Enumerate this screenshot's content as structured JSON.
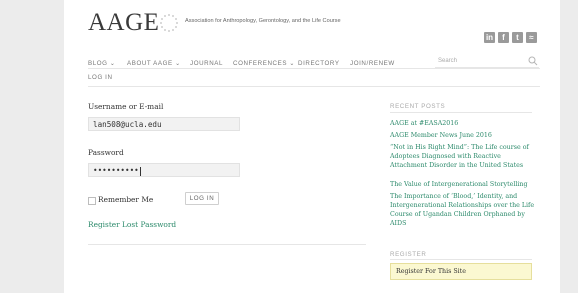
{
  "header": {
    "logo": "AAGE",
    "tagline": "Association for Anthropology, Gerontology, and the Life Course",
    "social_icons": [
      "linkedin-icon",
      "facebook-icon",
      "twitter-icon",
      "rss-icon"
    ]
  },
  "nav": {
    "items": [
      "BLOG ⌄",
      "ABOUT AAGE ⌄",
      "JOURNAL",
      "CONFERENCES ⌄",
      "DIRECTORY",
      "JOIN/RENEW"
    ],
    "login_tab": "LOG IN",
    "search_placeholder": "Search"
  },
  "form": {
    "username_label": "Username or E-mail",
    "username_value": "lan508@ucla.edu",
    "password_label": "Password",
    "password_value": "••••••••••",
    "remember_label": "Remember Me",
    "login_button": "LOG IN",
    "register_link": "Register",
    "lost_password_link": "Lost Password"
  },
  "sidebar": {
    "recent_posts_heading": "RECENT POSTS",
    "posts": [
      "AAGE at #EASA2016",
      "AAGE Member News June 2016",
      "“Not in His Right Mind”: The Life course of Adoptees Diagnosed with Reactive Attachment Disorder in the United States",
      "The Value of Intergenerational Storytelling",
      "The Importance of ‘Blood,’ Identity, and Intergenerational Relationships over the Life Course of Ugandan Children Orphaned by AIDS"
    ],
    "register_heading": "REGISTER",
    "register_link": "Register For This Site"
  },
  "colors": {
    "link": "#2c8a6b",
    "register_bg": "#fbf8d1",
    "page_bg": "#ececec"
  }
}
